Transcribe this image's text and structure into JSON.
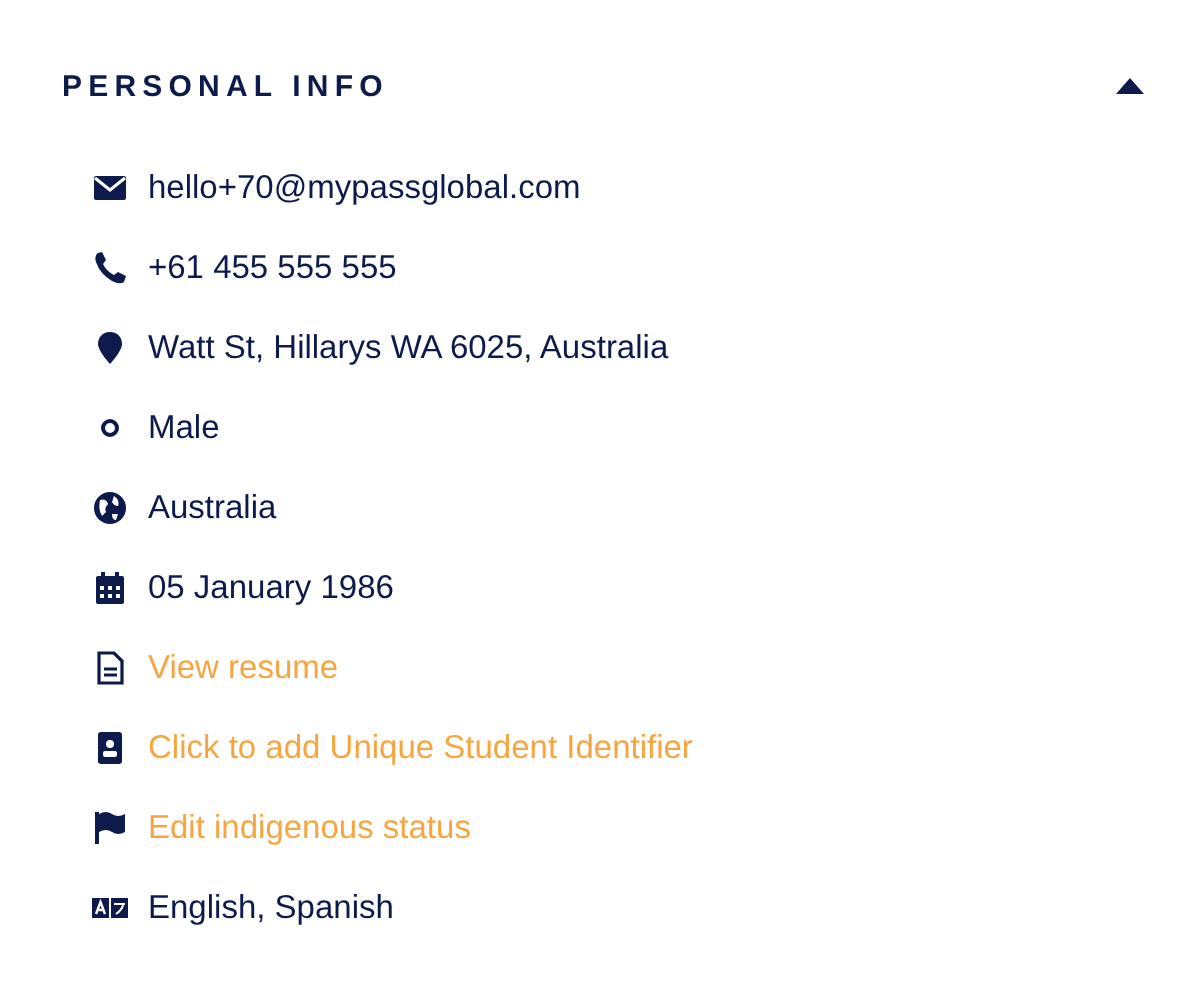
{
  "section": {
    "title": "PERSONAL INFO",
    "expanded": true
  },
  "items": [
    {
      "kind": "email",
      "link": false,
      "text": "hello+70@mypassglobal.com"
    },
    {
      "kind": "phone",
      "link": false,
      "text": "+61 455 555 555"
    },
    {
      "kind": "address",
      "link": false,
      "text": "Watt St, Hillarys WA 6025, Australia"
    },
    {
      "kind": "gender",
      "link": false,
      "text": "Male"
    },
    {
      "kind": "country",
      "link": false,
      "text": "Australia"
    },
    {
      "kind": "birthdate",
      "link": false,
      "text": "05 January 1986"
    },
    {
      "kind": "resume",
      "link": true,
      "text": "View resume"
    },
    {
      "kind": "identifier",
      "link": true,
      "text": "Click to add Unique Student Identifier"
    },
    {
      "kind": "indigenous",
      "link": true,
      "text": "Edit indigenous status"
    },
    {
      "kind": "languages",
      "link": false,
      "text": "English, Spanish"
    }
  ]
}
